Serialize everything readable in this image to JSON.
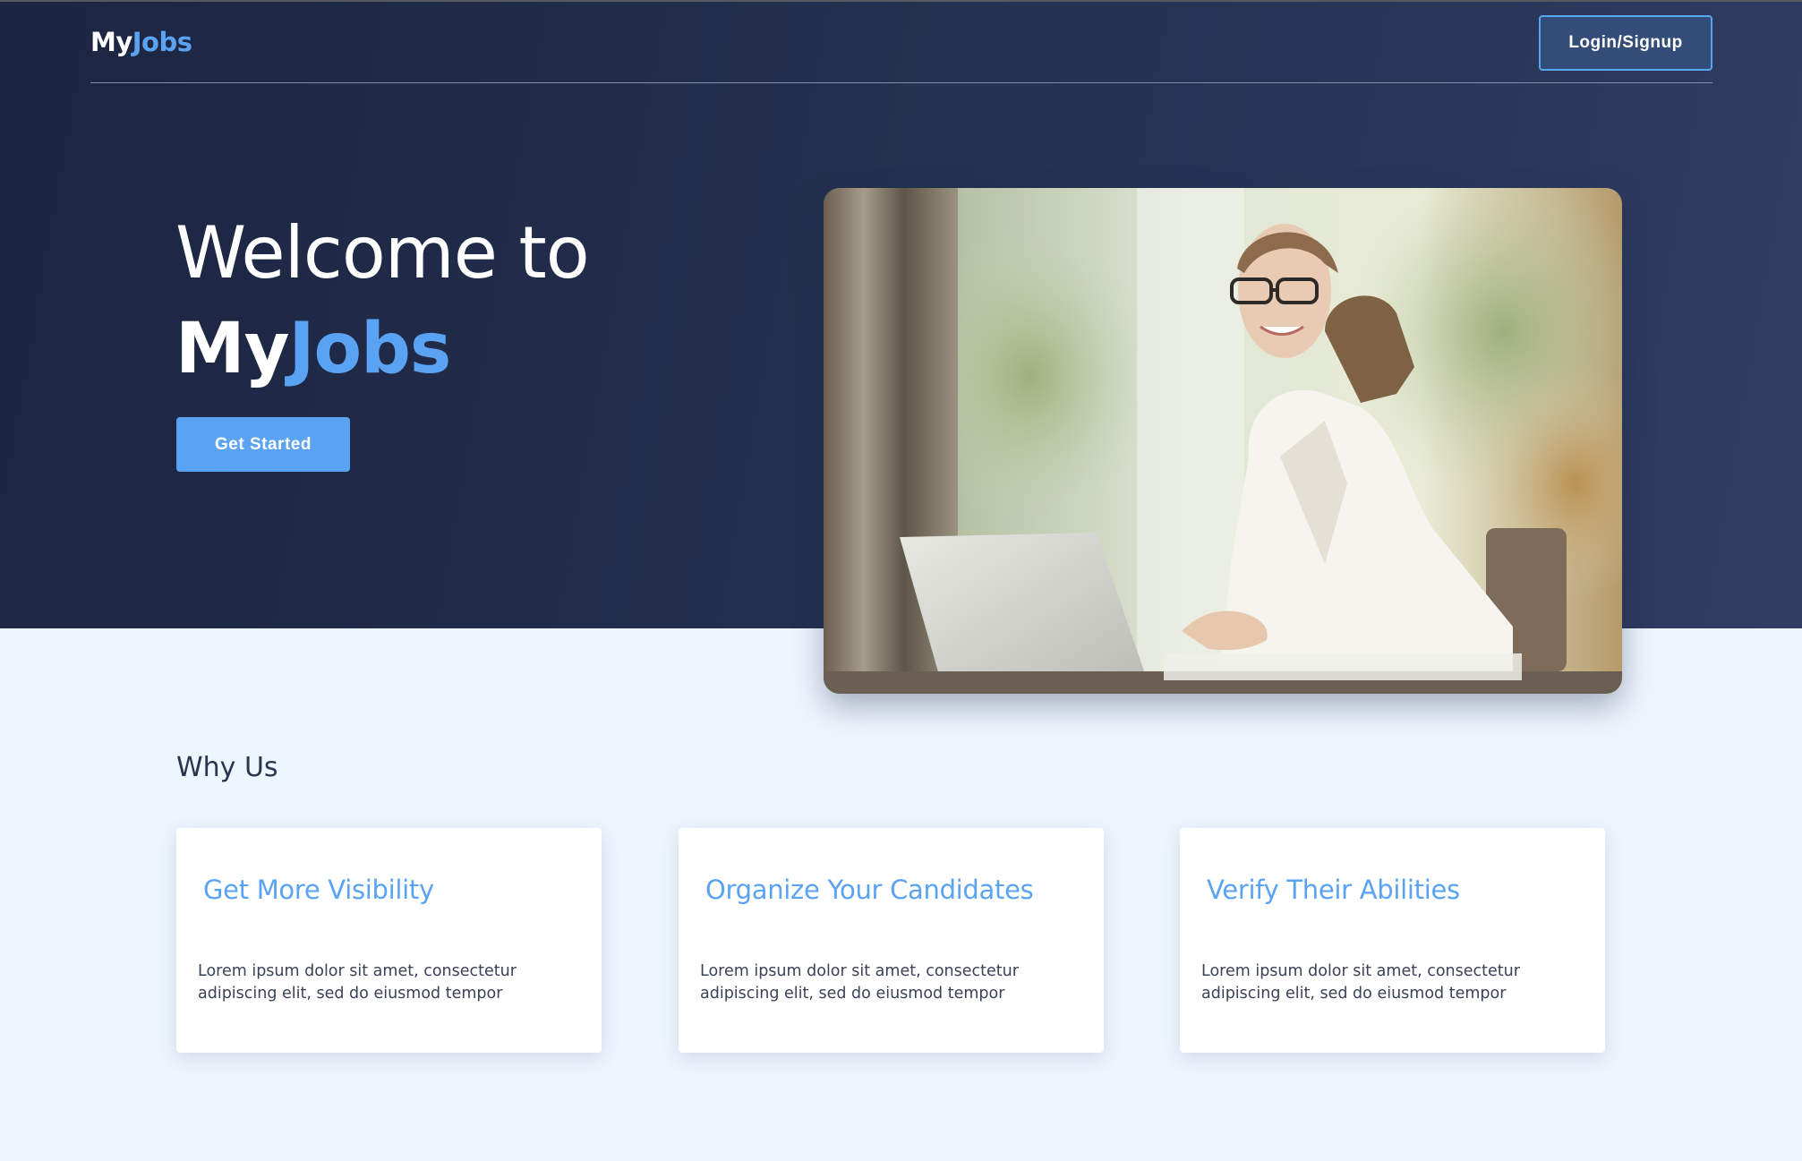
{
  "navbar": {
    "logo_my": "My",
    "logo_jobs": "Jobs",
    "login_label": "Login/Signup"
  },
  "hero": {
    "title_line1": "Welcome to",
    "title_my": "My",
    "title_jobs": "Jobs",
    "cta_label": "Get Started",
    "image_alt": "woman-at-laptop-photo"
  },
  "why_us": {
    "title": "Why Us",
    "cards": [
      {
        "title": "Get More Visibility",
        "text": "Lorem ipsum dolor sit amet, consectetur adipiscing elit, sed do eiusmod tempor"
      },
      {
        "title": "Organize Your Candidates",
        "text": "Lorem ipsum dolor sit amet, consectetur adipiscing elit, sed do eiusmod tempor"
      },
      {
        "title": "Verify Their Abilities",
        "text": "Lorem ipsum dolor sit amet, consectetur adipiscing elit, sed do eiusmod tempor"
      }
    ]
  },
  "colors": {
    "hero_bg": "#1c2541",
    "accent": "#5aa3f2",
    "page_bg": "#edf5fe",
    "card_bg": "#ffffff"
  }
}
